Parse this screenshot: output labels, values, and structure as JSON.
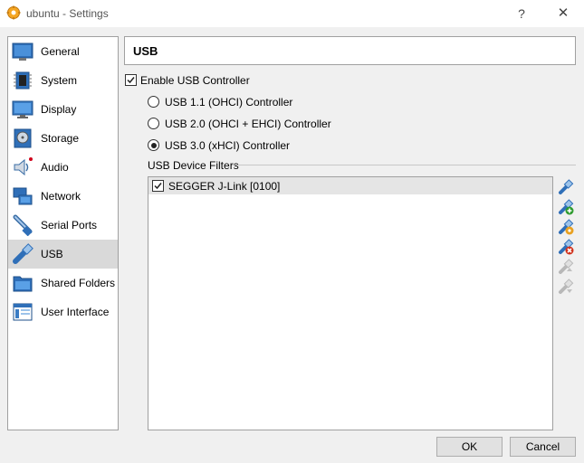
{
  "window": {
    "title": "ubuntu - Settings",
    "help_glyph": "?",
    "close_glyph": "✕"
  },
  "sidebar": {
    "items": [
      {
        "label": "General",
        "icon": "general-icon"
      },
      {
        "label": "System",
        "icon": "system-chip-icon"
      },
      {
        "label": "Display",
        "icon": "display-monitor-icon"
      },
      {
        "label": "Storage",
        "icon": "storage-disk-icon"
      },
      {
        "label": "Audio",
        "icon": "audio-speaker-icon"
      },
      {
        "label": "Network",
        "icon": "network-icon"
      },
      {
        "label": "Serial Ports",
        "icon": "serial-port-icon"
      },
      {
        "label": "USB",
        "icon": "usb-icon",
        "selected": true
      },
      {
        "label": "Shared Folders",
        "icon": "shared-folder-icon"
      },
      {
        "label": "User Interface",
        "icon": "user-interface-icon"
      }
    ]
  },
  "page": {
    "title": "USB"
  },
  "usb": {
    "enable_label": "Enable USB Controller",
    "enabled": true,
    "controllers": [
      {
        "label": "USB 1.1 (OHCI) Controller",
        "selected": false
      },
      {
        "label": "USB 2.0 (OHCI + EHCI) Controller",
        "selected": false
      },
      {
        "label": "USB 3.0 (xHCI) Controller",
        "selected": true
      }
    ],
    "filters_label": "USB Device Filters",
    "filters": [
      {
        "label": "SEGGER J-Link [0100]",
        "checked": true
      }
    ],
    "filter_buttons": [
      "add-filter-icon",
      "add-from-device-icon",
      "edit-filter-icon",
      "remove-filter-icon",
      "move-up-icon",
      "move-down-icon"
    ]
  },
  "footer": {
    "ok_label": "OK",
    "cancel_label": "Cancel"
  },
  "colors": {
    "selection": "#d9d9d9",
    "filter_row": "#e5e5e5",
    "background": "#f0f0f0"
  }
}
